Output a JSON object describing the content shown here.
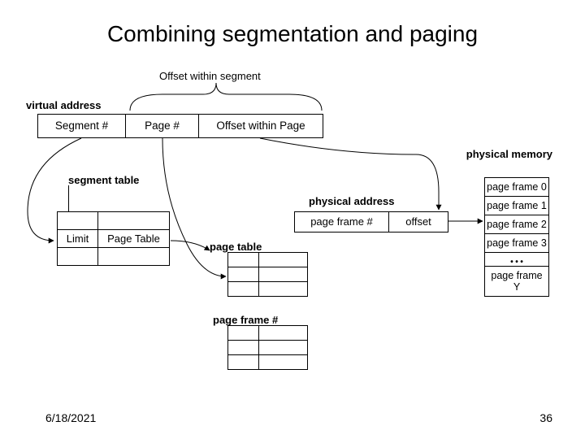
{
  "title": "Combining segmentation and paging",
  "labels": {
    "offset_within_segment": "Offset within segment",
    "virtual_address": "virtual address",
    "physical_memory": "physical memory",
    "segment_table": "segment table",
    "physical_address": "physical address",
    "page_table": "page table",
    "page_frame_num_hdr": "page frame #"
  },
  "virtual_address": {
    "segment": "Segment #",
    "page": "Page #",
    "offset": "Offset within Page"
  },
  "segment_table": {
    "cols": {
      "limit": "Limit",
      "ptbl": "Page Table"
    }
  },
  "physical_address": {
    "pf": "page frame #",
    "offset": "offset"
  },
  "pmem": {
    "frames": [
      "page frame 0",
      "page frame 1",
      "page frame 2",
      "page frame 3"
    ],
    "dots": "…",
    "last": "page frame Y"
  },
  "footer": {
    "date": "6/18/2021",
    "page": "36"
  }
}
